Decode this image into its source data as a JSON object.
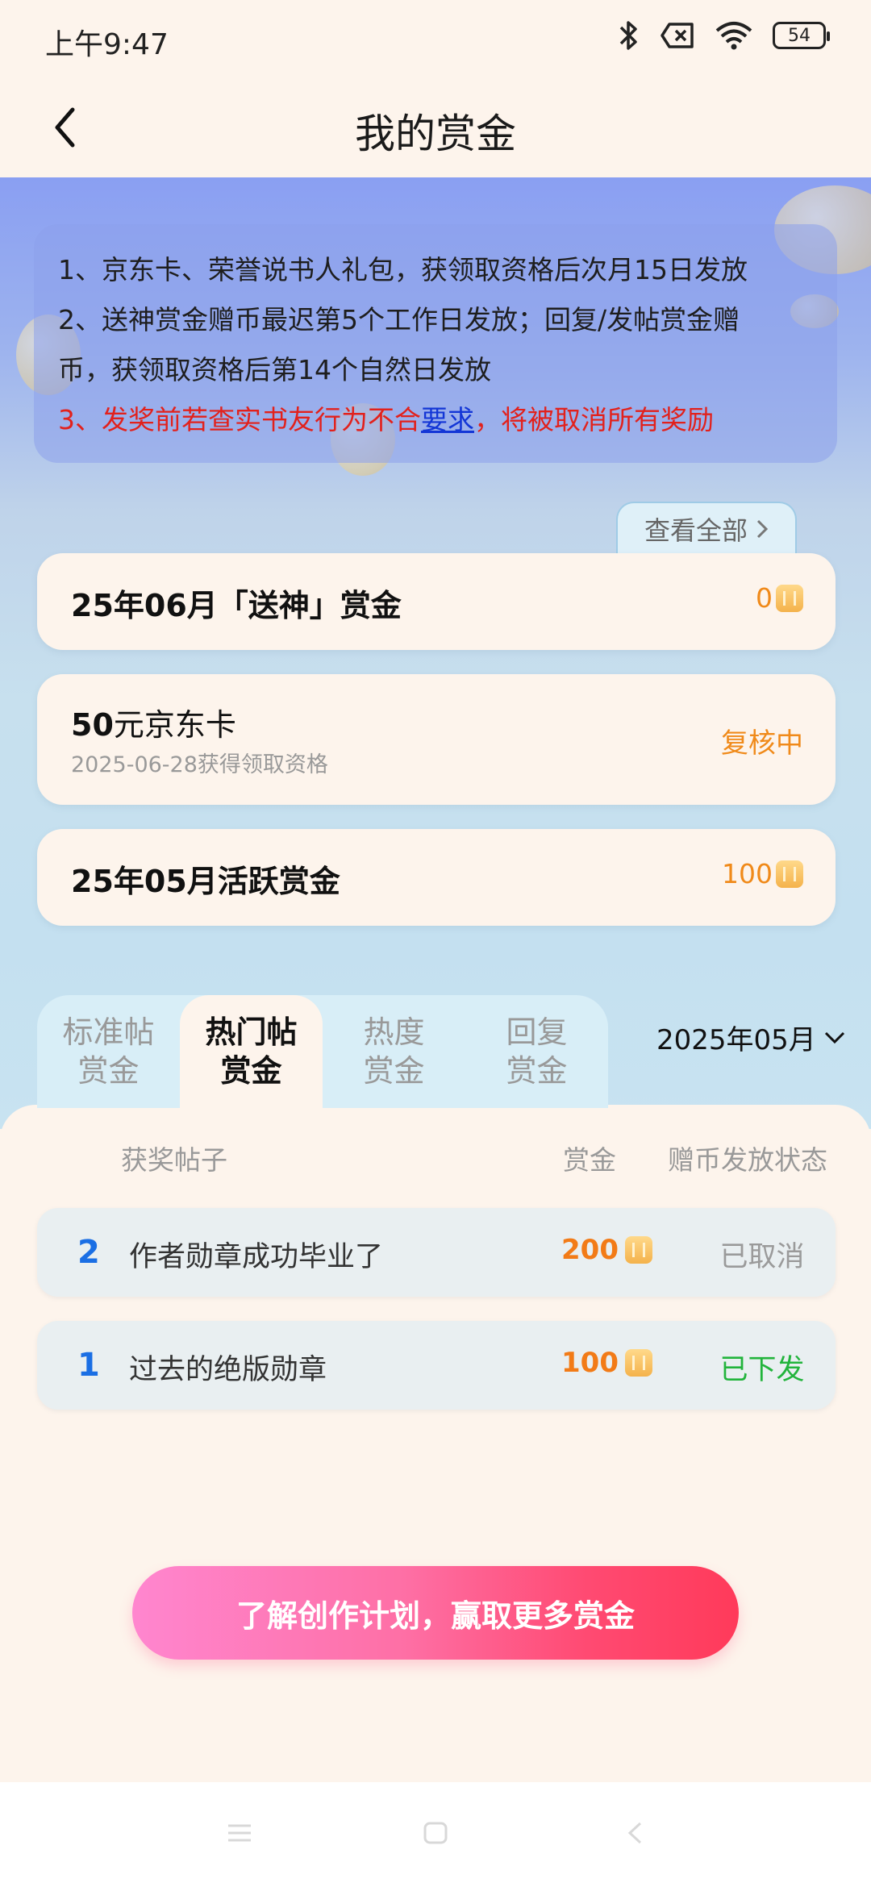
{
  "status_bar": {
    "time": "上午9:47",
    "battery": "54"
  },
  "header": {
    "title": "我的赏金"
  },
  "notice": {
    "line1": "1、京东卡、荣誉说书人礼包，获领取资格后次月15日发放",
    "line2a": "2、送神赏金赠币最迟第5个工作日发放；回复/发帖赏金赠",
    "line2b": "币，获领取资格后第14个自然日发放",
    "line3_before": "3、发奖前若查实书友行为不合",
    "line3_link": "要求",
    "line3_after": "，将被取消所有奖励"
  },
  "view_all_label": "查看全部",
  "cards": [
    {
      "title": "25年06月「送神」赏金",
      "value": "0"
    },
    {
      "title_num": "50",
      "title_rest": "元京东卡",
      "subtitle": "2025-06-28获得领取资格",
      "status": "复核中"
    },
    {
      "title": "25年05月活跃赏金",
      "value": "100"
    }
  ],
  "tabs": [
    {
      "line1": "标准帖",
      "line2": "赏金"
    },
    {
      "line1": "热门帖",
      "line2": "赏金"
    },
    {
      "line1": "热度",
      "line2": "赏金"
    },
    {
      "line1": "回复",
      "line2": "赏金"
    }
  ],
  "month_select": "2025年05月",
  "table": {
    "headers": {
      "post": "获奖帖子",
      "reward": "赏金",
      "status": "赠币发放状态"
    },
    "rows": [
      {
        "rank": "2",
        "title": "作者勋章成功毕业了",
        "reward": "200",
        "status": "已取消",
        "status_color": "#9a9a9a"
      },
      {
        "rank": "1",
        "title": "过去的绝版勋章",
        "reward": "100",
        "status": "已下发",
        "status_color": "#22b43c"
      }
    ]
  },
  "cta_label": "了解创作计划，赢取更多赏金",
  "colors": {
    "accent_orange": "#f08a1a",
    "rank_blue": "#1b6fe4",
    "warning_red": "#e2211c",
    "link_blue": "#1336d6"
  }
}
